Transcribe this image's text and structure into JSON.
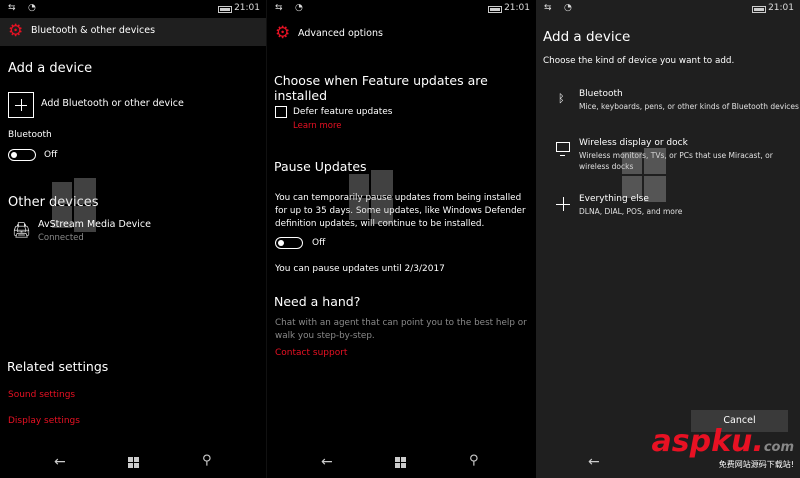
{
  "status": {
    "time": "21:01"
  },
  "panel1": {
    "header_title": "Bluetooth & other devices",
    "add_device_heading": "Add a device",
    "add_bluetooth_label": "Add Bluetooth or other device",
    "bluetooth_label": "Bluetooth",
    "bluetooth_state": "Off",
    "other_devices_heading": "Other devices",
    "device_name": "AvStream Media Device",
    "device_status": "Connected",
    "related_heading": "Related settings",
    "sound_link": "Sound settings",
    "display_link": "Display settings"
  },
  "panel2": {
    "header_title": "Advanced options",
    "feature_heading": "Choose when Feature updates are installed",
    "defer_label": "Defer feature updates",
    "learn_more": "Learn more",
    "pause_heading": "Pause Updates",
    "pause_desc_1": "You can temporarily pause updates from being installed",
    "pause_desc_2": "for up to 35 days. Some updates, like Windows Defender",
    "pause_desc_3": "definition updates, will continue to be installed.",
    "pause_state": "Off",
    "pause_until": "You can pause updates until 2/3/2017",
    "help_heading": "Need a hand?",
    "help_desc_1": "Chat with an agent that can point you to the best help or",
    "help_desc_2": "walk you step-by-step.",
    "contact_link": "Contact support"
  },
  "panel3": {
    "title": "Add a device",
    "subtitle": "Choose the kind of device you want to add.",
    "options": [
      {
        "title": "Bluetooth",
        "desc": [
          "Mice, keyboards, pens, or other kinds of Bluetooth devices"
        ]
      },
      {
        "title": "Wireless display or dock",
        "desc": [
          "Wireless monitors, TVs, or PCs that use Miracast, or",
          "wireless docks"
        ]
      },
      {
        "title": "Everything else",
        "desc": [
          "DLNA, DIAL, POS, and more"
        ]
      }
    ],
    "cancel_label": "Cancel"
  },
  "watermark": {
    "main": "aspku",
    "dot": ".",
    "com": "com",
    "sub": "免费网站源码下载站!"
  },
  "colors": {
    "accent": "#e81123",
    "panel3_bg": "#1f1f1f"
  }
}
